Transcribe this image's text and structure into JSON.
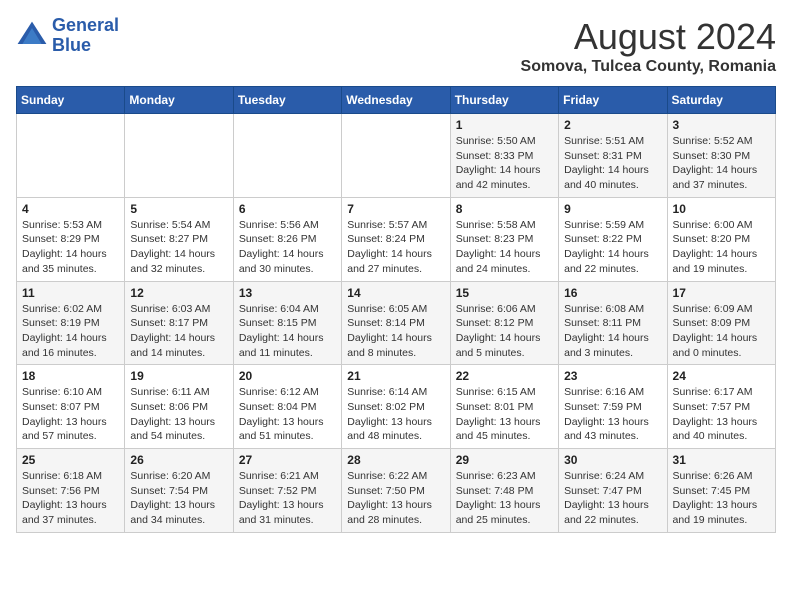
{
  "logo": {
    "line1": "General",
    "line2": "Blue"
  },
  "title": "August 2024",
  "subtitle": "Somova, Tulcea County, Romania",
  "days_of_week": [
    "Sunday",
    "Monday",
    "Tuesday",
    "Wednesday",
    "Thursday",
    "Friday",
    "Saturday"
  ],
  "weeks": [
    [
      {
        "day": "",
        "info": ""
      },
      {
        "day": "",
        "info": ""
      },
      {
        "day": "",
        "info": ""
      },
      {
        "day": "",
        "info": ""
      },
      {
        "day": "1",
        "info": "Sunrise: 5:50 AM\nSunset: 8:33 PM\nDaylight: 14 hours\nand 42 minutes."
      },
      {
        "day": "2",
        "info": "Sunrise: 5:51 AM\nSunset: 8:31 PM\nDaylight: 14 hours\nand 40 minutes."
      },
      {
        "day": "3",
        "info": "Sunrise: 5:52 AM\nSunset: 8:30 PM\nDaylight: 14 hours\nand 37 minutes."
      }
    ],
    [
      {
        "day": "4",
        "info": "Sunrise: 5:53 AM\nSunset: 8:29 PM\nDaylight: 14 hours\nand 35 minutes."
      },
      {
        "day": "5",
        "info": "Sunrise: 5:54 AM\nSunset: 8:27 PM\nDaylight: 14 hours\nand 32 minutes."
      },
      {
        "day": "6",
        "info": "Sunrise: 5:56 AM\nSunset: 8:26 PM\nDaylight: 14 hours\nand 30 minutes."
      },
      {
        "day": "7",
        "info": "Sunrise: 5:57 AM\nSunset: 8:24 PM\nDaylight: 14 hours\nand 27 minutes."
      },
      {
        "day": "8",
        "info": "Sunrise: 5:58 AM\nSunset: 8:23 PM\nDaylight: 14 hours\nand 24 minutes."
      },
      {
        "day": "9",
        "info": "Sunrise: 5:59 AM\nSunset: 8:22 PM\nDaylight: 14 hours\nand 22 minutes."
      },
      {
        "day": "10",
        "info": "Sunrise: 6:00 AM\nSunset: 8:20 PM\nDaylight: 14 hours\nand 19 minutes."
      }
    ],
    [
      {
        "day": "11",
        "info": "Sunrise: 6:02 AM\nSunset: 8:19 PM\nDaylight: 14 hours\nand 16 minutes."
      },
      {
        "day": "12",
        "info": "Sunrise: 6:03 AM\nSunset: 8:17 PM\nDaylight: 14 hours\nand 14 minutes."
      },
      {
        "day": "13",
        "info": "Sunrise: 6:04 AM\nSunset: 8:15 PM\nDaylight: 14 hours\nand 11 minutes."
      },
      {
        "day": "14",
        "info": "Sunrise: 6:05 AM\nSunset: 8:14 PM\nDaylight: 14 hours\nand 8 minutes."
      },
      {
        "day": "15",
        "info": "Sunrise: 6:06 AM\nSunset: 8:12 PM\nDaylight: 14 hours\nand 5 minutes."
      },
      {
        "day": "16",
        "info": "Sunrise: 6:08 AM\nSunset: 8:11 PM\nDaylight: 14 hours\nand 3 minutes."
      },
      {
        "day": "17",
        "info": "Sunrise: 6:09 AM\nSunset: 8:09 PM\nDaylight: 14 hours\nand 0 minutes."
      }
    ],
    [
      {
        "day": "18",
        "info": "Sunrise: 6:10 AM\nSunset: 8:07 PM\nDaylight: 13 hours\nand 57 minutes."
      },
      {
        "day": "19",
        "info": "Sunrise: 6:11 AM\nSunset: 8:06 PM\nDaylight: 13 hours\nand 54 minutes."
      },
      {
        "day": "20",
        "info": "Sunrise: 6:12 AM\nSunset: 8:04 PM\nDaylight: 13 hours\nand 51 minutes."
      },
      {
        "day": "21",
        "info": "Sunrise: 6:14 AM\nSunset: 8:02 PM\nDaylight: 13 hours\nand 48 minutes."
      },
      {
        "day": "22",
        "info": "Sunrise: 6:15 AM\nSunset: 8:01 PM\nDaylight: 13 hours\nand 45 minutes."
      },
      {
        "day": "23",
        "info": "Sunrise: 6:16 AM\nSunset: 7:59 PM\nDaylight: 13 hours\nand 43 minutes."
      },
      {
        "day": "24",
        "info": "Sunrise: 6:17 AM\nSunset: 7:57 PM\nDaylight: 13 hours\nand 40 minutes."
      }
    ],
    [
      {
        "day": "25",
        "info": "Sunrise: 6:18 AM\nSunset: 7:56 PM\nDaylight: 13 hours\nand 37 minutes."
      },
      {
        "day": "26",
        "info": "Sunrise: 6:20 AM\nSunset: 7:54 PM\nDaylight: 13 hours\nand 34 minutes."
      },
      {
        "day": "27",
        "info": "Sunrise: 6:21 AM\nSunset: 7:52 PM\nDaylight: 13 hours\nand 31 minutes."
      },
      {
        "day": "28",
        "info": "Sunrise: 6:22 AM\nSunset: 7:50 PM\nDaylight: 13 hours\nand 28 minutes."
      },
      {
        "day": "29",
        "info": "Sunrise: 6:23 AM\nSunset: 7:48 PM\nDaylight: 13 hours\nand 25 minutes."
      },
      {
        "day": "30",
        "info": "Sunrise: 6:24 AM\nSunset: 7:47 PM\nDaylight: 13 hours\nand 22 minutes."
      },
      {
        "day": "31",
        "info": "Sunrise: 6:26 AM\nSunset: 7:45 PM\nDaylight: 13 hours\nand 19 minutes."
      }
    ]
  ]
}
